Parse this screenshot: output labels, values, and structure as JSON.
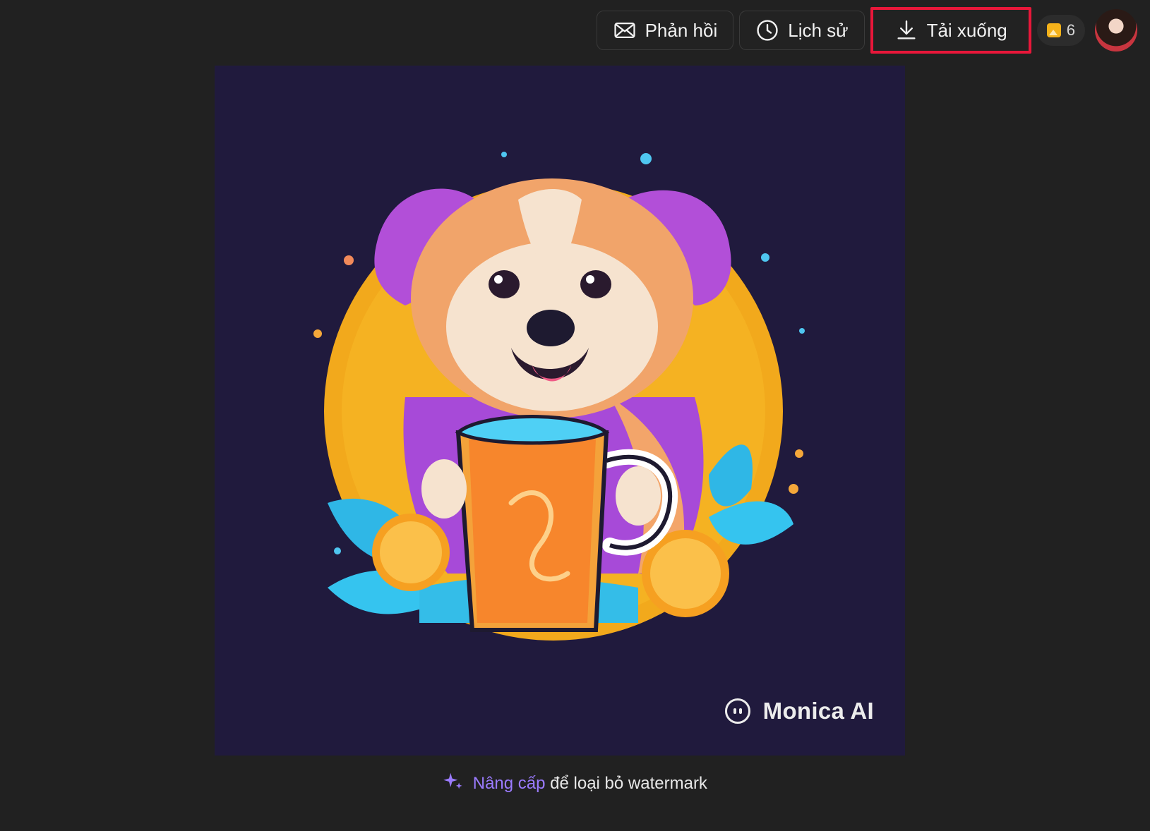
{
  "header": {
    "feedback_label": "Phản hồi",
    "history_label": "Lịch sử",
    "download_label": "Tải xuống",
    "credits_count": "6",
    "highlight_color": "#e8173a"
  },
  "image": {
    "watermark_text": "Monica AI",
    "background_color": "#201a3d"
  },
  "footer": {
    "upgrade_link_text": "Nâng cấp",
    "upgrade_rest_text": "để loại bỏ watermark",
    "link_color": "#9b7bff"
  }
}
